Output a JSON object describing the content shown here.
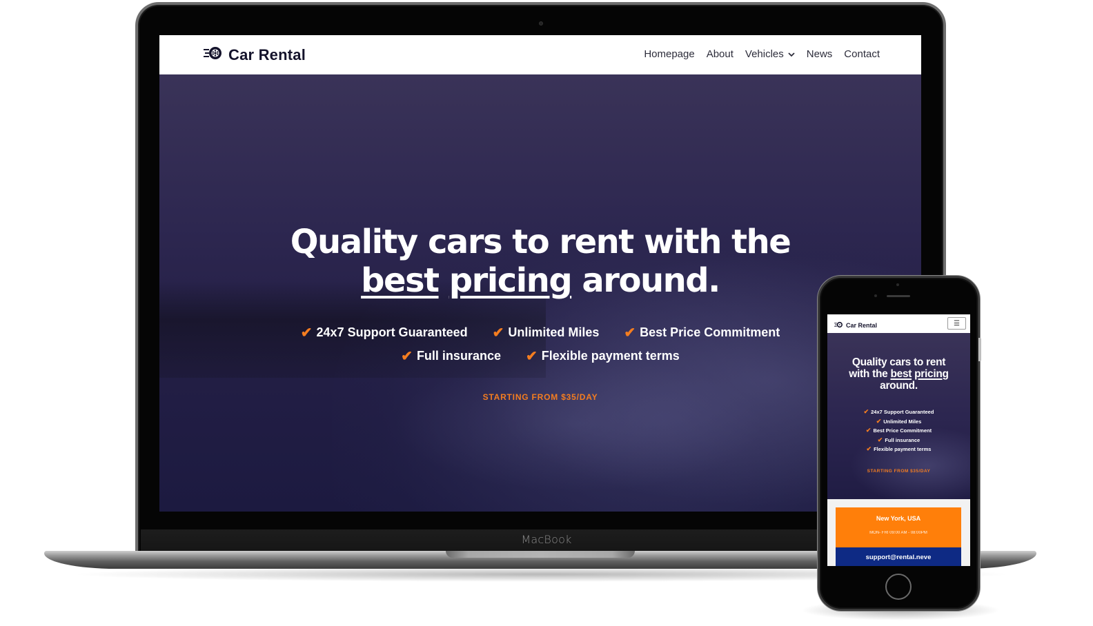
{
  "device_labels": {
    "laptop": "MacBook"
  },
  "site": {
    "brand": "Car Rental",
    "logo_icon": "wheel-icon",
    "nav": [
      {
        "label": "Homepage"
      },
      {
        "label": "About"
      },
      {
        "label": "Vehicles",
        "has_dropdown": true
      },
      {
        "label": "News"
      },
      {
        "label": "Contact"
      }
    ],
    "hero": {
      "title_line1": "Quality cars to rent with the",
      "title_underline1": "best",
      "title_underline2": "pricing",
      "title_end": "around.",
      "features": [
        "24x7 Support Guaranteed",
        "Unlimited Miles",
        "Best Price Commitment",
        "Full insurance",
        "Flexible payment terms"
      ],
      "cta": "STARTING FROM $35/DAY"
    },
    "colors": {
      "accent": "#f47d20",
      "navy": "#0e2a84",
      "orange_block": "#ff7f0a",
      "hero_overlay": "#2a2448"
    }
  },
  "mobile": {
    "brand": "Car Rental",
    "menu_icon": "hamburger-icon",
    "title_line1": "Quality cars to rent",
    "title_line2_prefix": "with the",
    "title_underline1": "best",
    "title_underline2": "pricing",
    "title_end": "around.",
    "features": [
      "24x7 Support Guaranteed",
      "Unlimited Miles",
      "Best Price Commitment",
      "Full insurance",
      "Flexible payment terms"
    ],
    "cta": "STARTING FROM $35/DAY",
    "info": {
      "city": "New York, USA",
      "hours": "MON- FRI 09:00 AM - 08:00PM",
      "email": "support@rental.neve"
    }
  }
}
